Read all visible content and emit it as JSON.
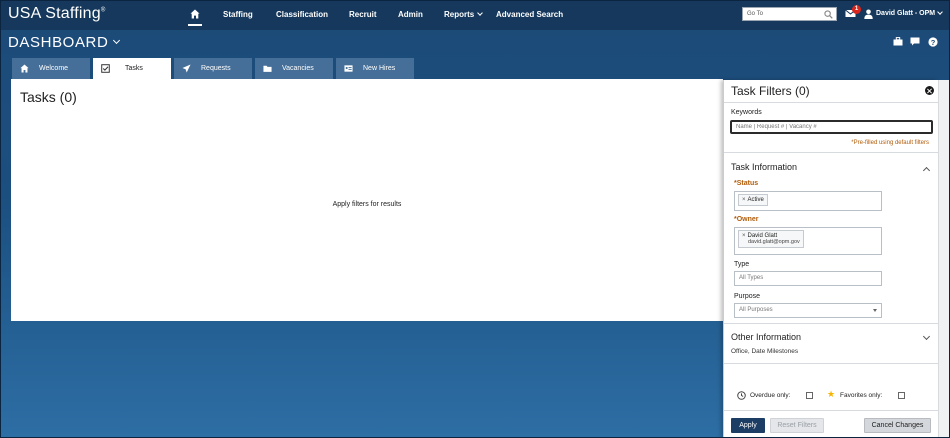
{
  "app": {
    "brand": "USA Staffing",
    "brand_mark": "®"
  },
  "nav": {
    "items": [
      "Staffing",
      "Classification",
      "Recruit",
      "Admin",
      "Reports",
      "Advanced Search"
    ],
    "goto_placeholder": "Go To",
    "notification_count": "1",
    "user_name": "David Glatt - OPM"
  },
  "dashboard": {
    "title": "DASHBOARD"
  },
  "tabs": [
    {
      "label": "Welcome",
      "icon": "home-icon"
    },
    {
      "label": "Tasks",
      "icon": "checkbox-icon"
    },
    {
      "label": "Requests",
      "icon": "send-icon"
    },
    {
      "label": "Vacancies",
      "icon": "folder-icon"
    },
    {
      "label": "New Hires",
      "icon": "id-card-icon"
    }
  ],
  "main": {
    "title": "Tasks (0)",
    "empty_message": "Apply filters for results"
  },
  "filters": {
    "title": "Task Filters (0)",
    "keywords_label": "Keywords",
    "keywords_placeholder": "Name | Request # | Vacancy #",
    "prefilled_note": "*Pre-filled using default filters",
    "task_info_title": "Task Information",
    "status_label": "*Status",
    "status_chip": "Active",
    "owner_label": "*Owner",
    "owner_name": "David Glatt",
    "owner_email": "david.glatt@opm.gov",
    "type_label": "Type",
    "type_placeholder": "All Types",
    "purpose_label": "Purpose",
    "purpose_value": "All Purposes",
    "other_info_title": "Other Information",
    "other_info_sub": "Office, Date Milestones",
    "overdue_label": "Overdue only:",
    "favorites_label": "Favorites only:",
    "apply_label": "Apply",
    "reset_label": "Reset Filters",
    "cancel_label": "Cancel Changes"
  },
  "colors": {
    "navbar": "#15385c",
    "accent_orange": "#b25c0a",
    "apply_button": "#1c3d64",
    "badge": "#d9261c"
  }
}
